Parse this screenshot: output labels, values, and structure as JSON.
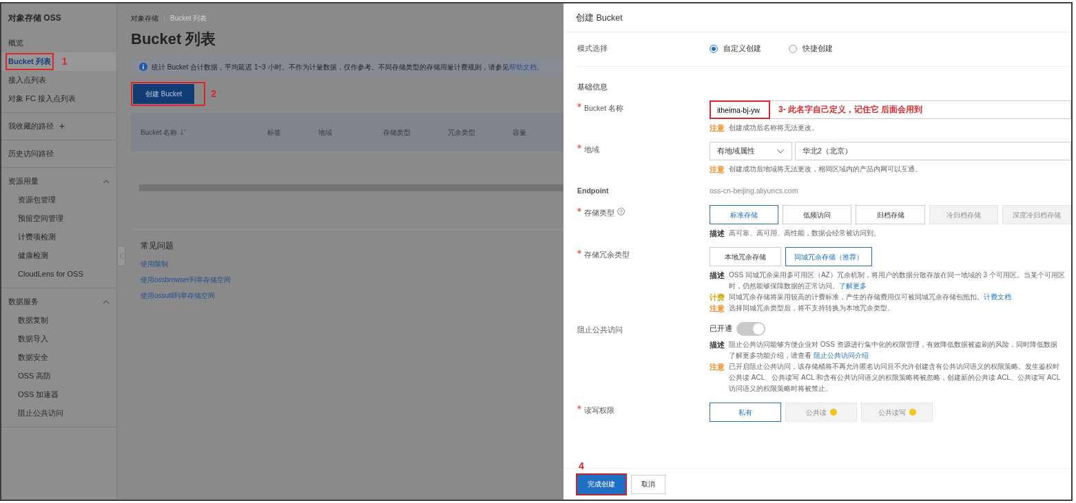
{
  "sidebar": {
    "title": "对象存储 OSS",
    "groups": [
      {
        "items": [
          {
            "label": "概览",
            "selected": false
          },
          {
            "label": "Bucket 列表",
            "selected": true,
            "annotation": "1"
          },
          {
            "label": "接入点列表",
            "selected": false
          },
          {
            "label": "对象 FC 接入点列表",
            "selected": false
          }
        ]
      },
      {
        "items": [
          {
            "label": "我收藏的路径",
            "selected": false,
            "action": "+"
          }
        ]
      },
      {
        "items": [
          {
            "label": "历史访问路径",
            "selected": false
          }
        ]
      },
      {
        "heading": "资源用量",
        "expanded": true,
        "items": [
          {
            "label": "资源包管理",
            "selected": false
          },
          {
            "label": "预留空间管理",
            "selected": false
          },
          {
            "label": "计费项检测",
            "selected": false
          },
          {
            "label": "健康检测",
            "selected": false
          },
          {
            "label": "CloudLens for OSS",
            "selected": false
          }
        ]
      },
      {
        "heading": "数据服务",
        "expanded": true,
        "items": [
          {
            "label": "数据复制",
            "selected": false
          },
          {
            "label": "数据导入",
            "selected": false
          },
          {
            "label": "数据安全",
            "selected": false
          },
          {
            "label": "OSS 高防",
            "selected": false
          },
          {
            "label": "OSS 加速器",
            "selected": false
          },
          {
            "label": "阻止公共访问",
            "selected": false
          }
        ]
      }
    ]
  },
  "main": {
    "breadcrumb": [
      "对象存储",
      "Bucket 列表"
    ],
    "title": "Bucket 列表",
    "notice": {
      "text": "统计 Bucket 合计数据，平均延迟 1~3 小时。不作为计量数据，仅作参考。不同存储类型的存储用量计费规则，请参见",
      "link": "帮助文档",
      "end": "。"
    },
    "create_button": {
      "label": "创建 Bucket",
      "annotation": "2"
    },
    "table": {
      "columns": [
        {
          "label": "Bucket 名称",
          "sortable": true
        },
        {
          "label": "标签",
          "sortable": false
        },
        {
          "label": "地域",
          "sortable": false
        },
        {
          "label": "存储类型",
          "sortable": false
        },
        {
          "label": "冗余类型",
          "sortable": false
        },
        {
          "label": "容量",
          "sortable": false
        }
      ]
    },
    "faq": {
      "title": "常见问题",
      "links": [
        "使用限制",
        "使用ossbrowser列举存储空间",
        "使用ossutil列举存储空间"
      ]
    }
  },
  "drawer": {
    "title": "创建 Bucket",
    "rows": [
      {
        "kind": "radio",
        "label": "模式选择",
        "options": [
          {
            "label": "自定义创建",
            "selected": true
          },
          {
            "label": "快捷创建",
            "selected": false
          }
        ]
      },
      {
        "kind": "section",
        "label": "基础信息"
      },
      {
        "kind": "input",
        "label": "Bucket 名称",
        "required": true,
        "value": "itheima-bj-yw",
        "annotation": "3- 此名字自己定义，记住它 后面会用到",
        "notes": [
          {
            "tag": "注意",
            "color": "#f08a1c",
            "lines": [
              {
                "text": "创建成功后名称将无法更改。"
              }
            ]
          }
        ]
      },
      {
        "kind": "select",
        "label": "地域",
        "required": true,
        "select": "有地域属性",
        "value": "华北2（北京）",
        "notes": [
          {
            "tag": "注意",
            "color": "#f08a1c",
            "lines": [
              {
                "text": "创建成功后地域将无法更改，相同区域内的产品内网可以互通。"
              }
            ]
          }
        ]
      },
      {
        "kind": "text",
        "label": "Endpoint",
        "value": "oss-cn-beijing.aliyuncs.com"
      },
      {
        "kind": "options",
        "label": "存储类型",
        "required": true,
        "help": true,
        "options": [
          {
            "label": "标准存储",
            "selected": true,
            "disabled": false
          },
          {
            "label": "低频访问",
            "selected": false,
            "disabled": false
          },
          {
            "label": "归档存储",
            "selected": false,
            "disabled": false
          },
          {
            "label": "冷归档存储",
            "selected": false,
            "disabled": true
          },
          {
            "label": "深度冷归档存储",
            "selected": false,
            "disabled": true
          }
        ],
        "notes": [
          {
            "tag": "描述",
            "color": "#333333",
            "lines": [
              {
                "text": "高可靠、高可用、高性能，数据会经常被访问到。"
              }
            ]
          }
        ]
      },
      {
        "kind": "options",
        "label": "存储冗余类型",
        "required": true,
        "options": [
          {
            "label": "本地冗余存储",
            "selected": false,
            "disabled": false
          },
          {
            "label": "同城冗余存储（推荐）",
            "selected": true,
            "disabled": false
          }
        ],
        "notes": [
          {
            "tag": "描述",
            "color": "#333333",
            "lines": [
              {
                "text": "OSS 同城冗余采用多可用区（AZ）冗余机制，将用户的数据分散存放在同一地域的 3 个可用区。当某个可用区"
              },
              {
                "text": "时，仍然能够保障数据的正常访问。",
                "link": "了解更多"
              }
            ]
          },
          {
            "tag": "计费",
            "color": "#d4a80c",
            "lines": [
              {
                "text": "同城冗余存储将采用较高的计费标准，产生的存储费用仅可被同城冗余存储包抵扣。",
                "link": "计费文档"
              }
            ]
          },
          {
            "tag": "注意",
            "color": "#f08a1c",
            "lines": [
              {
                "text": "选择同城冗余类型后，将不支持转换为本地冗余类型。"
              }
            ]
          }
        ]
      },
      {
        "kind": "switch",
        "label": "阻止公共访问",
        "status": "已开通",
        "on": true,
        "disabled": true,
        "notes": [
          {
            "tag": "描述",
            "color": "#333333",
            "lines": [
              {
                "text": "阻止公共访问能够方便企业对 OSS 资源进行集中化的权限管理，有效降低数据被盗刷的风险，同时降低数据"
              },
              {
                "text": "了解更多功能介绍，请查看 ",
                "link": "阻止公共访问介绍"
              }
            ]
          },
          {
            "tag": "注意",
            "color": "#f08a1c",
            "lines": [
              {
                "text": "已开启阻止公共访问，该存储桶将不再允许匿名访问且不允许创建含有公共访问语义的权限策略。发生鉴权时"
              },
              {
                "text": "公共读 ACL、公共读写 ACL 和含有公共访问语义的权限策略将被忽略，创建新的公共读 ACL、公共读写 ACL"
              },
              {
                "text": "访问语义的权限策略时将被禁止。"
              }
            ]
          }
        ]
      },
      {
        "kind": "options",
        "label": "读写权限",
        "required": true,
        "options": [
          {
            "label": "私有",
            "selected": true,
            "disabled": false
          },
          {
            "label": "公共读",
            "selected": false,
            "disabled": true,
            "warning": true
          },
          {
            "label": "公共读写",
            "selected": false,
            "disabled": true,
            "warning": true
          }
        ]
      }
    ],
    "footer": [
      {
        "label": "完成创建",
        "kind": "primary",
        "annotation": "4"
      },
      {
        "label": "取消",
        "kind": "default"
      }
    ]
  }
}
